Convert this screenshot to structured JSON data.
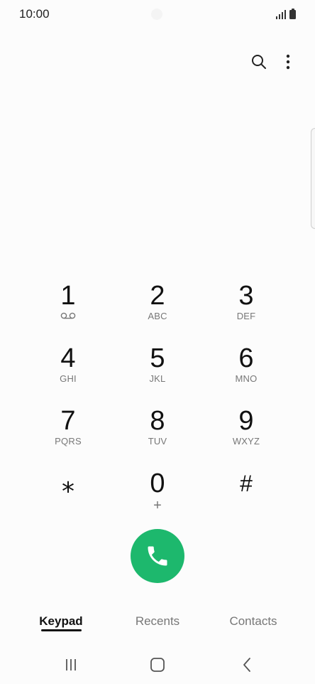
{
  "status_bar": {
    "time": "10:00",
    "icons": [
      "signal-icon",
      "battery-icon"
    ]
  },
  "toolbar": {
    "icons": [
      "search-icon",
      "more-vertical-icon"
    ]
  },
  "keypad": {
    "keys": [
      {
        "digit": "1",
        "letters": "",
        "sub_icon": "voicemail-icon"
      },
      {
        "digit": "2",
        "letters": "ABC"
      },
      {
        "digit": "3",
        "letters": "DEF"
      },
      {
        "digit": "4",
        "letters": "GHI"
      },
      {
        "digit": "5",
        "letters": "JKL"
      },
      {
        "digit": "6",
        "letters": "MNO"
      },
      {
        "digit": "7",
        "letters": "PQRS"
      },
      {
        "digit": "8",
        "letters": "TUV"
      },
      {
        "digit": "9",
        "letters": "WXYZ"
      },
      {
        "digit": "⁎",
        "letters": ""
      },
      {
        "digit": "0",
        "letters": "+"
      },
      {
        "digit": "#",
        "letters": ""
      }
    ]
  },
  "call": {
    "icon": "phone-icon",
    "color": "#1db86d"
  },
  "tabs": [
    {
      "label": "Keypad",
      "active": true
    },
    {
      "label": "Recents",
      "active": false
    },
    {
      "label": "Contacts",
      "active": false
    }
  ],
  "nav_bar": {
    "icons": [
      "recent-apps-icon",
      "home-icon",
      "back-icon"
    ]
  }
}
